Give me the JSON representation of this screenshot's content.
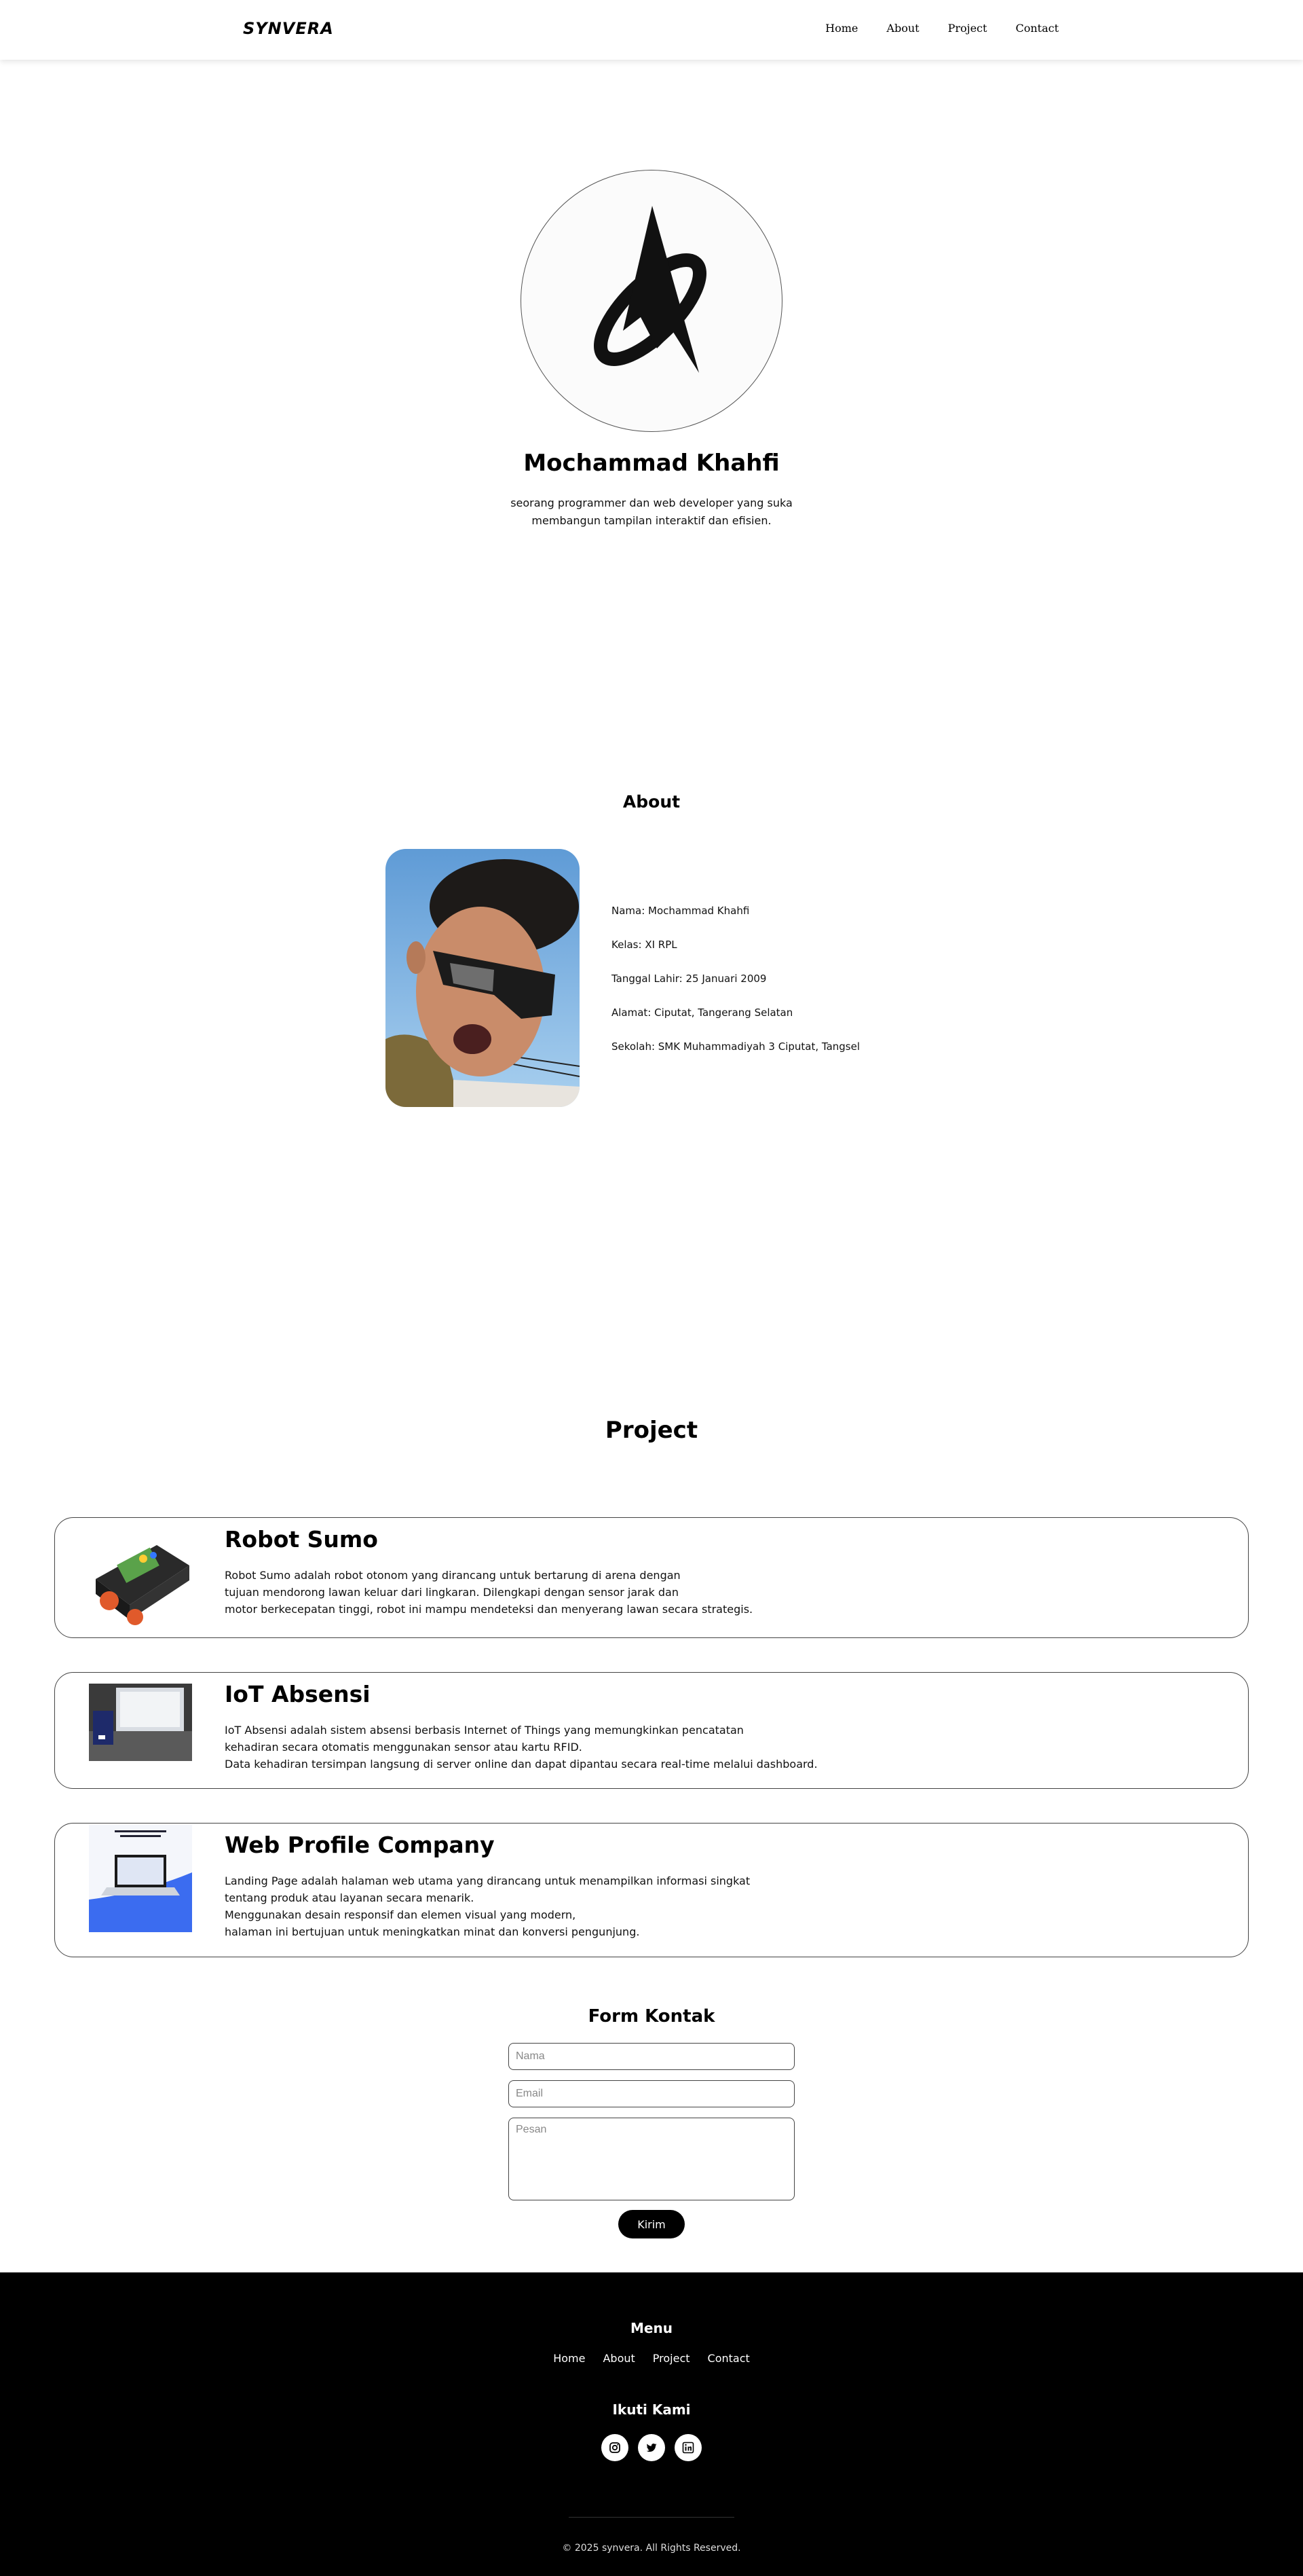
{
  "navbar": {
    "brand": "SYNVERA",
    "links": [
      "Home",
      "About",
      "Project",
      "Contact"
    ]
  },
  "hero": {
    "logo_icon": "compass-orbit-logo-icon",
    "name": "Mochammad Khahfi",
    "description": "seorang programmer dan web developer yang suka membangun tampilan interaktif dan efisien."
  },
  "about": {
    "title": "About",
    "photo_icon": "profile-photo",
    "info": [
      "Nama: Mochammad Khahfi",
      "Kelas: XI RPL",
      "Tanggal Lahir: 25 Januari 2009",
      "Alamat: Ciputat, Tangerang Selatan",
      "Sekolah: SMK Muhammadiyah 3 Ciputat, Tangsel"
    ]
  },
  "project": {
    "title": "Project",
    "items": [
      {
        "title": "Robot Sumo",
        "lines": [
          "Robot Sumo adalah robot otonom yang dirancang untuk bertarung di arena dengan",
          "tujuan mendorong lawan keluar dari lingkaran. Dilengkapi dengan sensor jarak dan",
          "motor berkecepatan tinggi, robot ini mampu mendeteksi dan menyerang lawan secara strategis."
        ]
      },
      {
        "title": "IoT Absensi",
        "lines": [
          "IoT Absensi adalah sistem absensi berbasis Internet of Things yang memungkinkan pencatatan",
          "kehadiran secara otomatis menggunakan sensor atau kartu RFID.",
          "Data kehadiran tersimpan langsung di server online dan dapat dipantau secara real-time melalui dashboard."
        ]
      },
      {
        "title": "Web Profile Company",
        "lines": [
          "Landing Page adalah halaman web utama yang dirancang untuk menampilkan informasi singkat",
          "tentang produk atau layanan secara menarik.",
          "Menggunakan desain responsif dan elemen visual yang modern,",
          "halaman ini bertujuan untuk meningkatkan minat dan konversi pengunjung."
        ]
      }
    ]
  },
  "contact": {
    "title": "Form Kontak",
    "name_placeholder": "Nama",
    "email_placeholder": "Email",
    "message_placeholder": "Pesan",
    "submit": "Kirim"
  },
  "footer": {
    "menu_title": "Menu",
    "links": [
      "Home",
      "About",
      "Project",
      "Contact"
    ],
    "follow_title": "Ikuti Kami",
    "socials": [
      "instagram-icon",
      "twitter-icon",
      "linkedin-icon"
    ],
    "copyright": "© 2025 synvera. All Rights Reserved."
  }
}
